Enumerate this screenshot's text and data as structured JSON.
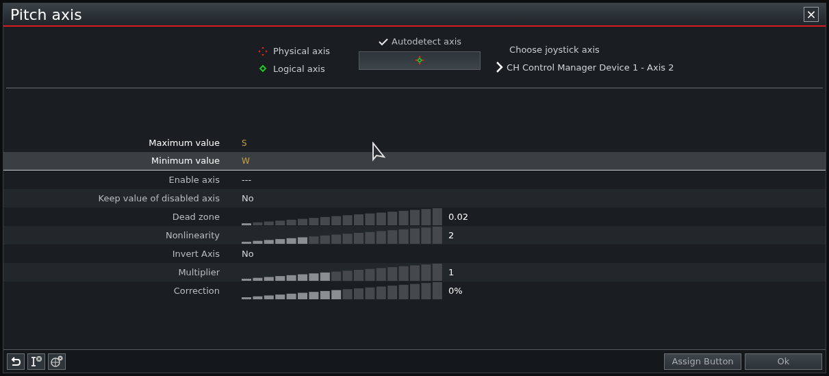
{
  "window": {
    "title": "Pitch axis",
    "close": "×"
  },
  "legend": [
    {
      "kind": "physical",
      "label": "Physical axis"
    },
    {
      "kind": "logical",
      "label": "Logical axis"
    }
  ],
  "autodetect": {
    "label": "Autodetect axis",
    "checked": true
  },
  "joystick": {
    "heading": "Choose joystick axis",
    "device": "CH Control Manager Device 1 - Axis 2"
  },
  "settings": [
    {
      "kind": "binding",
      "label": "Maximum value",
      "value": "S",
      "selected": false
    },
    {
      "kind": "binding",
      "label": "Minimum value",
      "value": "W",
      "selected": true
    },
    {
      "kind": "text",
      "label": "Enable axis",
      "value": "---",
      "selected": false
    },
    {
      "kind": "text",
      "label": "Keep value of disabled axis",
      "value": "No",
      "selected": false
    },
    {
      "kind": "slider",
      "label": "Dead zone",
      "value": "0.02",
      "level": 0.05,
      "selected": false
    },
    {
      "kind": "slider",
      "label": "Nonlinearity",
      "value": "2",
      "level": 0.33,
      "selected": false
    },
    {
      "kind": "text",
      "label": "Invert Axis",
      "value": "No",
      "selected": false
    },
    {
      "kind": "slider",
      "label": "Multiplier",
      "value": "1",
      "level": 0.44,
      "selected": false
    },
    {
      "kind": "slider",
      "label": "Correction",
      "value": "0%",
      "level": 0.5,
      "selected": false
    }
  ],
  "buttons": [
    "Assign Button",
    "Ok"
  ]
}
